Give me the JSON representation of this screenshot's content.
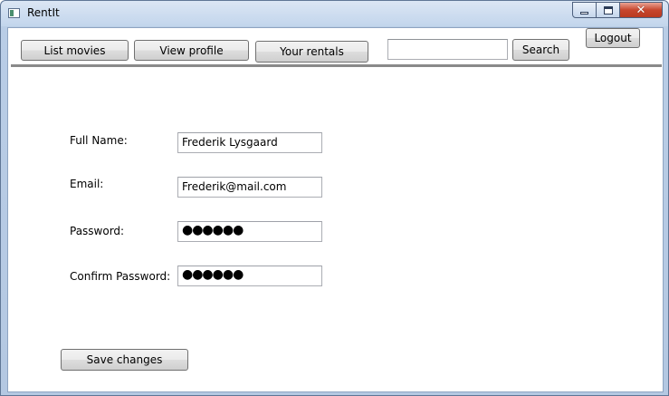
{
  "window": {
    "title": "RentIt",
    "close_glyph": "✕"
  },
  "toolbar": {
    "list_movies_label": "List movies",
    "view_profile_label": "View profile",
    "your_rentals_label": "Your rentals",
    "search_value": "",
    "search_label": "Search",
    "logout_label": "Logout"
  },
  "profile_form": {
    "full_name_label": "Full Name:",
    "full_name_value": "Frederik Lysgaard",
    "email_label": "Email:",
    "email_value": "Frederik@mail.com",
    "password_label": "Password:",
    "password_value": "●●●●●●",
    "confirm_password_label": "Confirm Password:",
    "confirm_password_value": "●●●●●●",
    "save_label": "Save changes"
  }
}
